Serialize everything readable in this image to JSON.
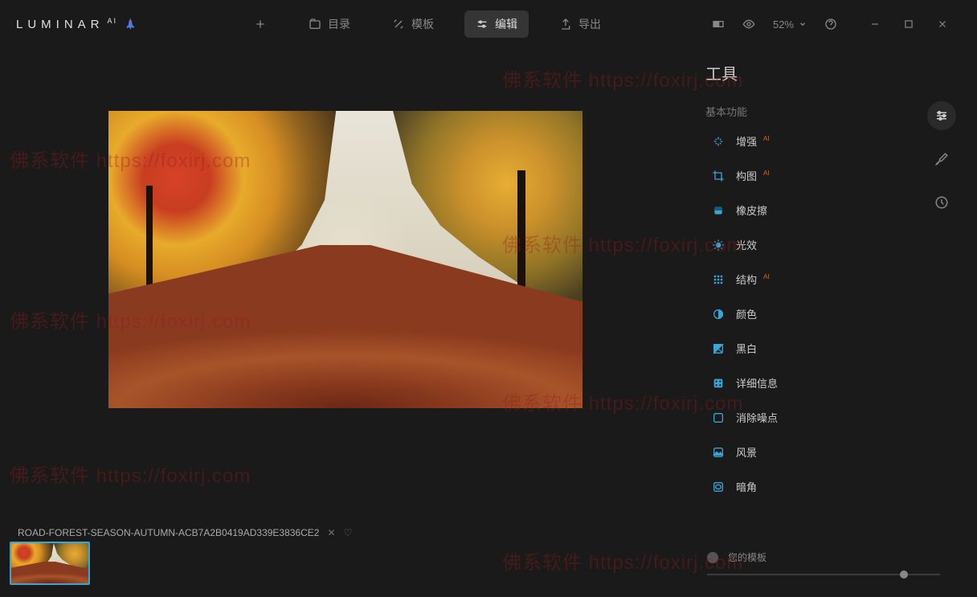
{
  "app": {
    "name": "LUMINAR",
    "suffix": "AI"
  },
  "nav": {
    "catalog": "目录",
    "templates": "模板",
    "edit": "编辑",
    "export": "导出"
  },
  "zoom": "52%",
  "panel": {
    "title": "工具",
    "section": "基本功能",
    "tools": [
      {
        "label": "增强",
        "ai": true,
        "icon": "sparkle"
      },
      {
        "label": "构图",
        "ai": true,
        "icon": "crop"
      },
      {
        "label": "橡皮擦",
        "ai": false,
        "icon": "eraser"
      },
      {
        "label": "光效",
        "ai": false,
        "icon": "light"
      },
      {
        "label": "结构",
        "ai": true,
        "icon": "structure"
      },
      {
        "label": "颜色",
        "ai": false,
        "icon": "color"
      },
      {
        "label": "黑白",
        "ai": false,
        "icon": "bw"
      },
      {
        "label": "详细信息",
        "ai": false,
        "icon": "details"
      },
      {
        "label": "消除噪点",
        "ai": false,
        "icon": "denoise"
      },
      {
        "label": "风景",
        "ai": false,
        "icon": "landscape"
      },
      {
        "label": "暗角",
        "ai": false,
        "icon": "vignette"
      }
    ]
  },
  "file": {
    "name": "ROAD-FOREST-SEASON-AUTUMN-ACB7A2B0419AD339E3836CE2"
  },
  "templates_label": "您的模板",
  "watermark": "佛系软件 https://foxirj.com"
}
